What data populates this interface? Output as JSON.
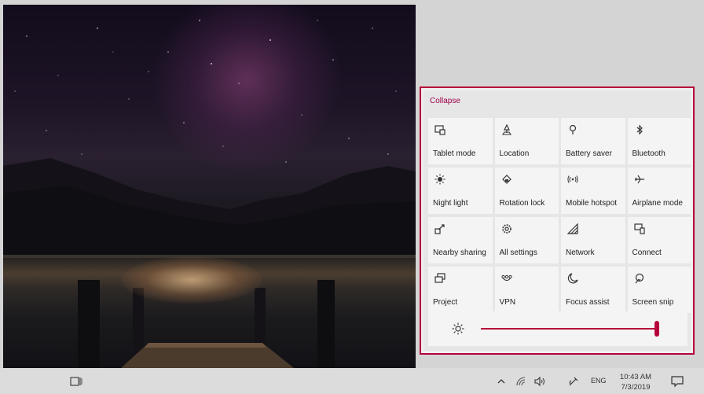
{
  "action_center": {
    "collapse_label": "Collapse",
    "accent_color": "#b5003a",
    "tiles": [
      {
        "label": "Tablet mode",
        "icon": "tablet-mode-icon"
      },
      {
        "label": "Location",
        "icon": "location-icon"
      },
      {
        "label": "Battery saver",
        "icon": "battery-saver-icon"
      },
      {
        "label": "Bluetooth",
        "icon": "bluetooth-icon"
      },
      {
        "label": "Night light",
        "icon": "night-light-icon"
      },
      {
        "label": "Rotation lock",
        "icon": "rotation-lock-icon"
      },
      {
        "label": "Mobile hotspot",
        "icon": "mobile-hotspot-icon"
      },
      {
        "label": "Airplane mode",
        "icon": "airplane-mode-icon"
      },
      {
        "label": "Nearby sharing",
        "icon": "nearby-sharing-icon"
      },
      {
        "label": "All settings",
        "icon": "settings-gear-icon"
      },
      {
        "label": "Network",
        "icon": "network-icon"
      },
      {
        "label": "Connect",
        "icon": "connect-icon"
      },
      {
        "label": "Project",
        "icon": "project-icon"
      },
      {
        "label": "VPN",
        "icon": "vpn-icon"
      },
      {
        "label": "Focus assist",
        "icon": "focus-assist-icon"
      },
      {
        "label": "Screen snip",
        "icon": "screen-snip-icon"
      }
    ],
    "brightness_level": 1.0
  },
  "taskbar": {
    "language": "ENG",
    "time": "10:43 AM",
    "date": "7/3/2019"
  }
}
